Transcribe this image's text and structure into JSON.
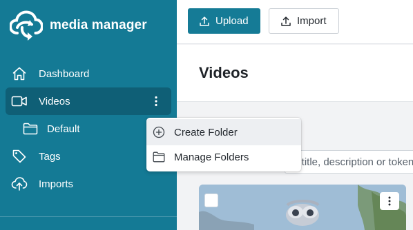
{
  "brand": {
    "name": "media manager"
  },
  "sidebar": {
    "items": [
      {
        "label": "Dashboard",
        "icon": "home-icon"
      },
      {
        "label": "Videos",
        "icon": "video-camera-icon",
        "active": true
      },
      {
        "label": "Default",
        "icon": "folder-icon"
      },
      {
        "label": "Tags",
        "icon": "tag-icon"
      },
      {
        "label": "Imports",
        "icon": "cloud-upload-icon"
      }
    ]
  },
  "toolbar": {
    "upload_label": "Upload",
    "import_label": "Import"
  },
  "page": {
    "title": "Videos"
  },
  "search": {
    "value": "y title, description or token"
  },
  "context_menu": {
    "items": [
      {
        "label": "Create Folder",
        "icon": "plus-circle-icon",
        "highlighted": true
      },
      {
        "label": "Manage Folders",
        "icon": "folder-icon"
      }
    ]
  },
  "colors": {
    "sidebar": "#147a95",
    "sidebar_active": "#0f5f76",
    "primary": "#157b96"
  }
}
